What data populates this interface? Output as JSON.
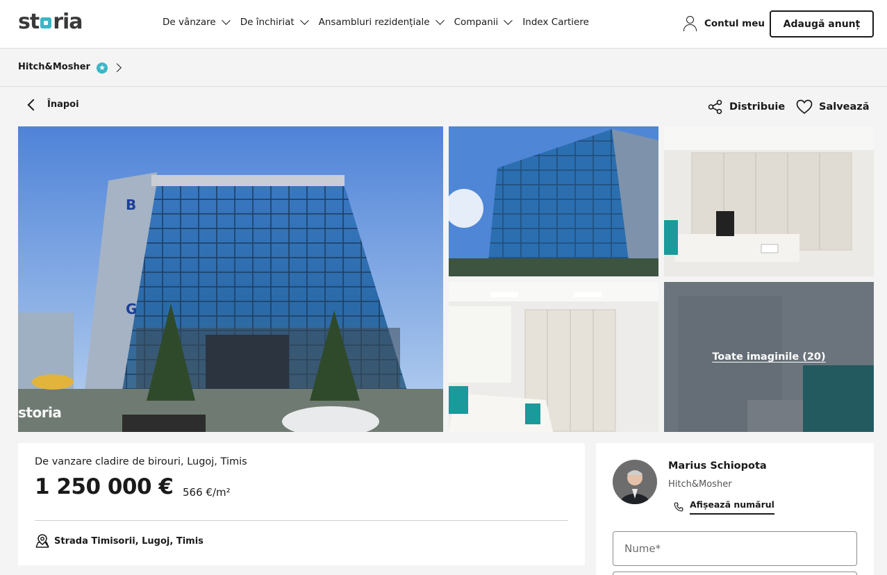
{
  "header": {
    "logo": "storia",
    "nav": [
      {
        "label": "De vânzare",
        "has_dropdown": true
      },
      {
        "label": "De închiriat",
        "has_dropdown": true
      },
      {
        "label": "Ansambluri rezidențiale",
        "has_dropdown": true
      },
      {
        "label": "Companii",
        "has_dropdown": true
      },
      {
        "label": "Index Cartiere",
        "has_dropdown": false
      }
    ],
    "account_label": "Contul meu",
    "add_listing_label": "Adaugă anunț"
  },
  "agency_bar": {
    "name": "Hitch&Mosher",
    "badge_icon": "star-badge-icon"
  },
  "actions": {
    "back_label": "Înapoi",
    "share_label": "Distribuie",
    "save_label": "Salvează"
  },
  "gallery": {
    "all_images_label": "Toate imaginile (20)",
    "watermark": "storia",
    "photos": [
      {
        "name": "main-building-photo"
      },
      {
        "name": "building-facade-photo"
      },
      {
        "name": "office-interior-photo-1"
      },
      {
        "name": "office-interior-photo-2"
      },
      {
        "name": "office-interior-photo-3"
      }
    ]
  },
  "listing": {
    "title": "De vanzare cladire de birouri, Lugoj, Timis",
    "price": "1 250 000 €",
    "price_per_sqm": "566 €/m²",
    "address": "Strada Timisorii, Lugoj, Timis"
  },
  "agent": {
    "name": "Marius Schiopota",
    "company": "Hitch&Mosher",
    "show_number_label": "Afișează numărul",
    "name_placeholder": "Nume*"
  },
  "colors": {
    "brand": "#39b7c6",
    "text": "#1a1a1a",
    "page_bg": "#f4f4f4"
  }
}
